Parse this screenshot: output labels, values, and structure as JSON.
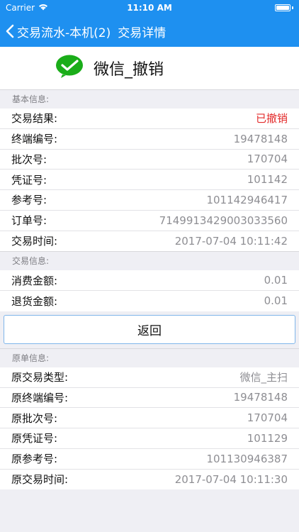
{
  "status_bar": {
    "carrier": "Carrier",
    "time": "11:10 AM"
  },
  "nav": {
    "back_label": "交易流水-本机(2)",
    "title": "交易详情"
  },
  "header": {
    "title": "微信_撤销",
    "icon": "wechat-logo-icon",
    "icon_color": "#1aad19"
  },
  "colors": {
    "accent": "#1e90f0",
    "cancelled": "#e32b2b"
  },
  "sections": [
    {
      "title": "基本信息:",
      "rows": [
        {
          "label": "交易结果:",
          "value": "已撤销"
        },
        {
          "label": "终端编号:",
          "value": "19478148"
        },
        {
          "label": "批次号:",
          "value": "170704"
        },
        {
          "label": "凭证号:",
          "value": "101142"
        },
        {
          "label": "参考号:",
          "value": "101142946417"
        },
        {
          "label": "订单号:",
          "value": "7149913429003033560"
        },
        {
          "label": "交易时间:",
          "value": "2017-07-04 10:11:42"
        }
      ]
    },
    {
      "title": "交易信息:",
      "rows": [
        {
          "label": "消费金额:",
          "value": "0.01"
        },
        {
          "label": "退货金额:",
          "value": "0.01"
        }
      ]
    },
    {
      "title": "原单信息:",
      "rows": [
        {
          "label": "原交易类型:",
          "value": "微信_主扫"
        },
        {
          "label": "原终端编号:",
          "value": "19478148"
        },
        {
          "label": "原批次号:",
          "value": "170704"
        },
        {
          "label": "原凭证号:",
          "value": "101129"
        },
        {
          "label": "原参考号:",
          "value": "101130946387"
        },
        {
          "label": "原交易时间:",
          "value": "2017-07-04 10:11:30"
        }
      ]
    }
  ],
  "return_button": "返回"
}
